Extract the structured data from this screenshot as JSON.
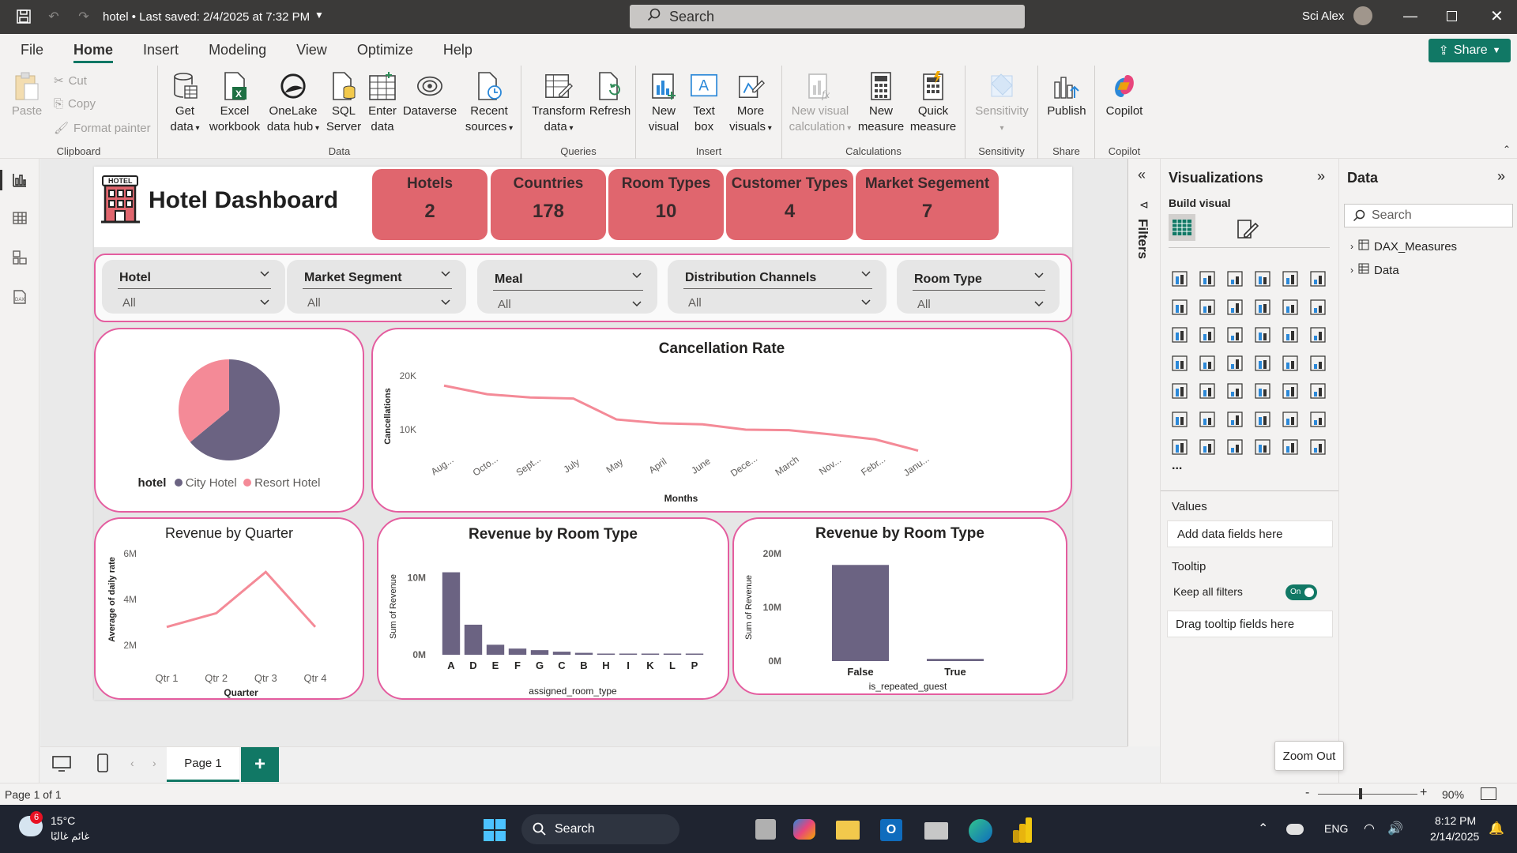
{
  "titlebar": {
    "title": "hotel • Last saved: 2/4/2025 at 7:32 PM",
    "search_placeholder": "Search",
    "user": "Sci Alex"
  },
  "menu": {
    "items": [
      "File",
      "Home",
      "Insert",
      "Modeling",
      "View",
      "Optimize",
      "Help"
    ],
    "active": "Home",
    "share_label": "Share"
  },
  "ribbon": {
    "clipboard": {
      "paste": "Paste",
      "cut": "Cut",
      "copy": "Copy",
      "format_painter": "Format painter",
      "label": "Clipboard"
    },
    "data": {
      "get_data": [
        "Get",
        "data"
      ],
      "excel": [
        "Excel",
        "workbook"
      ],
      "onelake": [
        "OneLake",
        "data hub"
      ],
      "sql": [
        "SQL",
        "Server"
      ],
      "enter": [
        "Enter",
        "data"
      ],
      "dataverse": "Dataverse",
      "recent": [
        "Recent",
        "sources"
      ],
      "label": "Data"
    },
    "queries": {
      "transform": [
        "Transform",
        "data"
      ],
      "refresh": "Refresh",
      "label": "Queries"
    },
    "insert": {
      "new_visual": [
        "New",
        "visual"
      ],
      "text_box": [
        "Text",
        "box"
      ],
      "more_visuals": [
        "More",
        "visuals"
      ],
      "label": "Insert"
    },
    "calculations": {
      "new_visual_calc": [
        "New visual",
        "calculation"
      ],
      "new_measure": [
        "New",
        "measure"
      ],
      "quick_measure": [
        "Quick",
        "measure"
      ],
      "label": "Calculations"
    },
    "sensitivity": {
      "btn": "Sensitivity",
      "label": "Sensitivity"
    },
    "share": {
      "publish": "Publish",
      "label": "Share"
    },
    "copilot": {
      "btn": "Copilot",
      "label": "Copilot"
    }
  },
  "report": {
    "title": "Hotel Dashboard",
    "logo_text": "HOTEL",
    "kpis": [
      {
        "label": "Hotels",
        "value": "2"
      },
      {
        "label": "Countries",
        "value": "178"
      },
      {
        "label": "Room Types",
        "value": "10"
      },
      {
        "label": "Customer Types",
        "value": "4"
      },
      {
        "label": "Market Segement",
        "value": "7"
      }
    ],
    "slicers": [
      {
        "title": "Hotel",
        "value": "All"
      },
      {
        "title": "Market Segment",
        "value": "All"
      },
      {
        "title": "Meal",
        "value": "All"
      },
      {
        "title": "Distribution Channels",
        "value": "All"
      },
      {
        "title": "Room Type",
        "value": "All"
      }
    ],
    "pie_legend": {
      "title": "hotel",
      "items": [
        "City Hotel",
        "Resort Hotel"
      ]
    }
  },
  "chart_data": [
    {
      "type": "pie",
      "legend_title": "hotel",
      "categories": [
        "City Hotel",
        "Resort Hotel"
      ],
      "values": [
        0.64,
        0.36
      ],
      "colors": [
        "#6b6382",
        "#f48a97"
      ]
    },
    {
      "type": "line",
      "title": "Cancellation Rate",
      "xlabel": "Months",
      "ylabel": "Cancellations",
      "categories": [
        "Aug...",
        "Octo...",
        "Sept...",
        "July",
        "May",
        "April",
        "June",
        "Dece...",
        "March",
        "Nov...",
        "Febr...",
        "Janu..."
      ],
      "values": [
        18200,
        16600,
        16000,
        15800,
        11900,
        11200,
        11000,
        10000,
        9900,
        9100,
        8200,
        6100
      ],
      "yticks": [
        "20K",
        "10K"
      ],
      "ylim": [
        0,
        25000
      ],
      "color": "#f48a97"
    },
    {
      "type": "line",
      "title": "Revenue by Quarter",
      "xlabel": "Quarter",
      "ylabel": "Average of daily rate",
      "categories": [
        "Qtr 1",
        "Qtr 2",
        "Qtr 3",
        "Qtr 4"
      ],
      "values": [
        2800000,
        3400000,
        5200000,
        2800000
      ],
      "yticks": [
        "6M",
        "4M",
        "2M"
      ],
      "ylim": [
        2000000,
        6000000
      ],
      "color": "#f48a97"
    },
    {
      "type": "bar",
      "title": "Revenue by Room Type",
      "xlabel": "assigned_room_type",
      "ylabel": "Sum of Revenue",
      "categories": [
        "A",
        "D",
        "E",
        "F",
        "G",
        "C",
        "B",
        "H",
        "I",
        "K",
        "L",
        "P"
      ],
      "values": [
        10700000,
        3900000,
        1300000,
        800000,
        600000,
        400000,
        250000,
        150000,
        80000,
        50000,
        30000,
        10000
      ],
      "yticks": [
        "10M",
        "0M"
      ],
      "ylim": [
        0,
        12500000
      ],
      "color": "#6b6382"
    },
    {
      "type": "bar",
      "title": "Revenue by Room Type",
      "xlabel": "is_repeated_guest",
      "ylabel": "Sum of Revenue",
      "categories": [
        "False",
        "True"
      ],
      "values": [
        17900000,
        400000
      ],
      "yticks": [
        "20M",
        "10M",
        "0M"
      ],
      "ylim": [
        0,
        20000000
      ],
      "color": "#6b6382"
    }
  ],
  "filters_label": "Filters",
  "viz_pane": {
    "title": "Visualizations",
    "build_visual": "Build visual",
    "values_label": "Values",
    "values_placeholder": "Add data fields here",
    "tooltip_label": "Tooltip",
    "keep_filters": "Keep all filters",
    "toggle": "On",
    "tooltip_placeholder": "Drag tooltip fields here",
    "more": "..."
  },
  "data_pane": {
    "title": "Data",
    "search_placeholder": "Search",
    "tables": [
      "DAX_Measures",
      "Data"
    ]
  },
  "pages": {
    "tab": "Page 1",
    "add": "+"
  },
  "status": {
    "page": "Page 1 of 1",
    "zoom": "90%",
    "zoom_out_tooltip": "Zoom Out"
  },
  "taskbar": {
    "temp": "15°C",
    "weather_badge": "6",
    "weather_text": "غائم غالبًا",
    "search": "Search",
    "lang": "ENG",
    "time": "8:12 PM",
    "date": "2/14/2025"
  }
}
